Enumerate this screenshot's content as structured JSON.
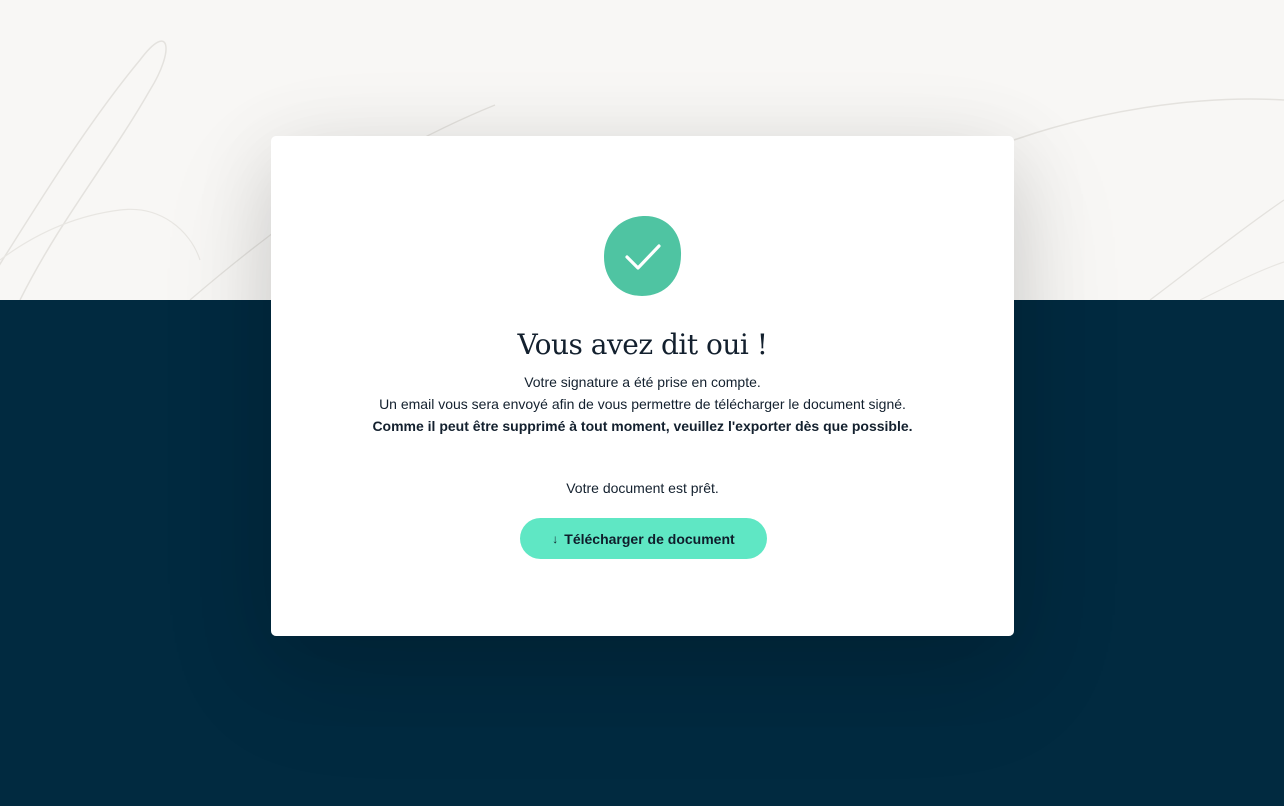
{
  "colors": {
    "background_top": "#f8f7f5",
    "background_bottom": "#012a40",
    "accent_green": "#5fe7c4",
    "badge_green": "#4fc4a2",
    "text": "#13202e"
  },
  "modal": {
    "icon": "check-circle-icon",
    "title": "Vous avez dit oui !",
    "message_line_1": "Votre signature a été prise en compte.",
    "message_line_2": "Un email vous sera envoyé afin de vous permettre de télécharger le document signé.",
    "message_line_3": "Comme il peut être supprimé à tout moment, veuillez l'exporter dès que possible.",
    "ready_text": "Votre document est prêt.",
    "download_button": {
      "icon": "download-arrow-icon",
      "arrow_glyph": "↓",
      "label": "Télécharger de document"
    }
  }
}
